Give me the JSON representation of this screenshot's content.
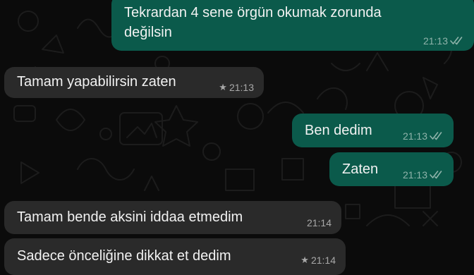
{
  "messages": [
    {
      "direction": "out",
      "lines": [
        "Tekrardan 4 sene örgün okumak zorunda",
        "değilsin"
      ],
      "time": "21:13",
      "status_icon": "double-check-icon"
    },
    {
      "direction": "in",
      "text": "Tamam yapabilirsin zaten",
      "time": "21:13",
      "starred": true
    },
    {
      "direction": "out",
      "text": "Ben dedim",
      "time": "21:13",
      "status_icon": "double-check-icon"
    },
    {
      "direction": "out",
      "text": "Zaten",
      "time": "21:13",
      "status_icon": "double-check-icon"
    },
    {
      "direction": "in",
      "text": "Tamam bende aksini iddaa etmedim",
      "time": "21:14"
    },
    {
      "direction": "in",
      "text": "Sadece önceliğine dikkat et dedim",
      "time": "21:14",
      "starred": true
    }
  ],
  "icons": {
    "star": "★",
    "status": "double-check-icon"
  },
  "colors": {
    "background": "#0b0b0b",
    "outgoing_bubble": "#0b5a4b",
    "incoming_bubble": "#2a2a2a",
    "text": "#f2f2f2"
  }
}
